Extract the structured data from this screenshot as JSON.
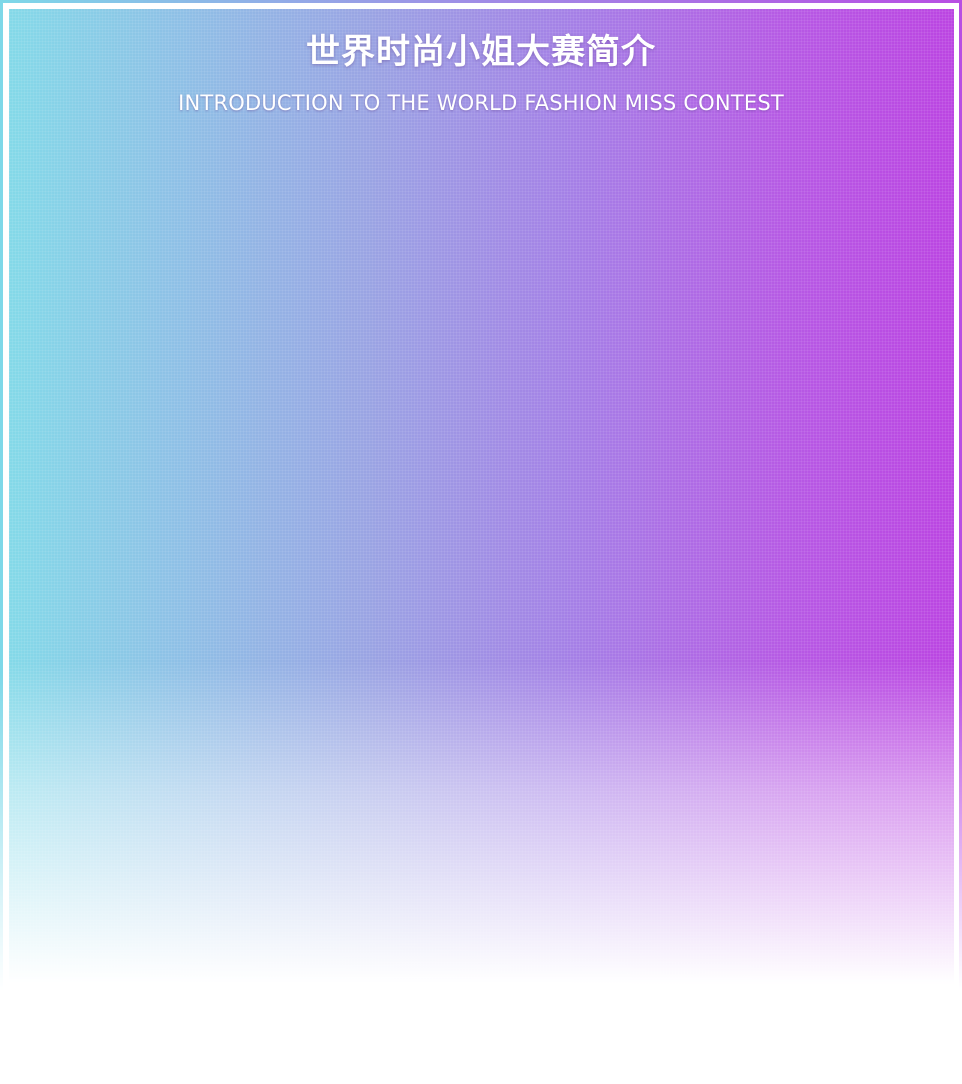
{
  "header": {
    "title_cn": "世界时尚小姐大赛简介",
    "title_en": "INTRODUCTION TO THE WORLD FASHION MISS CONTEST"
  },
  "colors": {
    "gradient_left": "#84d9e8",
    "gradient_mid": "#a57fe6",
    "gradient_right": "#bb45e2",
    "text": "#ffffff",
    "background": "#ffffff"
  }
}
